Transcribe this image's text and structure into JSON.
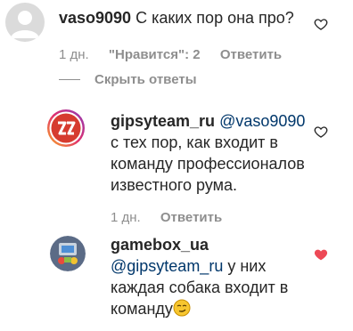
{
  "comments": [
    {
      "username": "vaso9090",
      "text": "С каких пор она про?",
      "time": "1 дн.",
      "likes": "\"Нравится\": 2",
      "reply": "Ответить",
      "liked": false
    },
    {
      "username": "gipsyteam_ru",
      "mention": "@vaso9090",
      "text_lines": [
        "с тех пор, как входит в",
        "команду профессионалов",
        "известного рума."
      ],
      "time": "1 дн.",
      "reply": "Ответить",
      "liked": false
    },
    {
      "username": "gamebox_ua",
      "mention": "@gipsyteam_ru",
      "text_lines": [
        "у них",
        "каждая собака входит в",
        "команду"
      ],
      "liked": true
    }
  ],
  "hide_replies": "Скрыть ответы",
  "colors": {
    "like_red": "#ed4956",
    "mention_blue": "#00376b",
    "meta_gray": "#8e8e8e"
  },
  "icons": [
    "heart-outline-icon",
    "heart-filled-icon",
    "smirk-emoji-icon"
  ]
}
